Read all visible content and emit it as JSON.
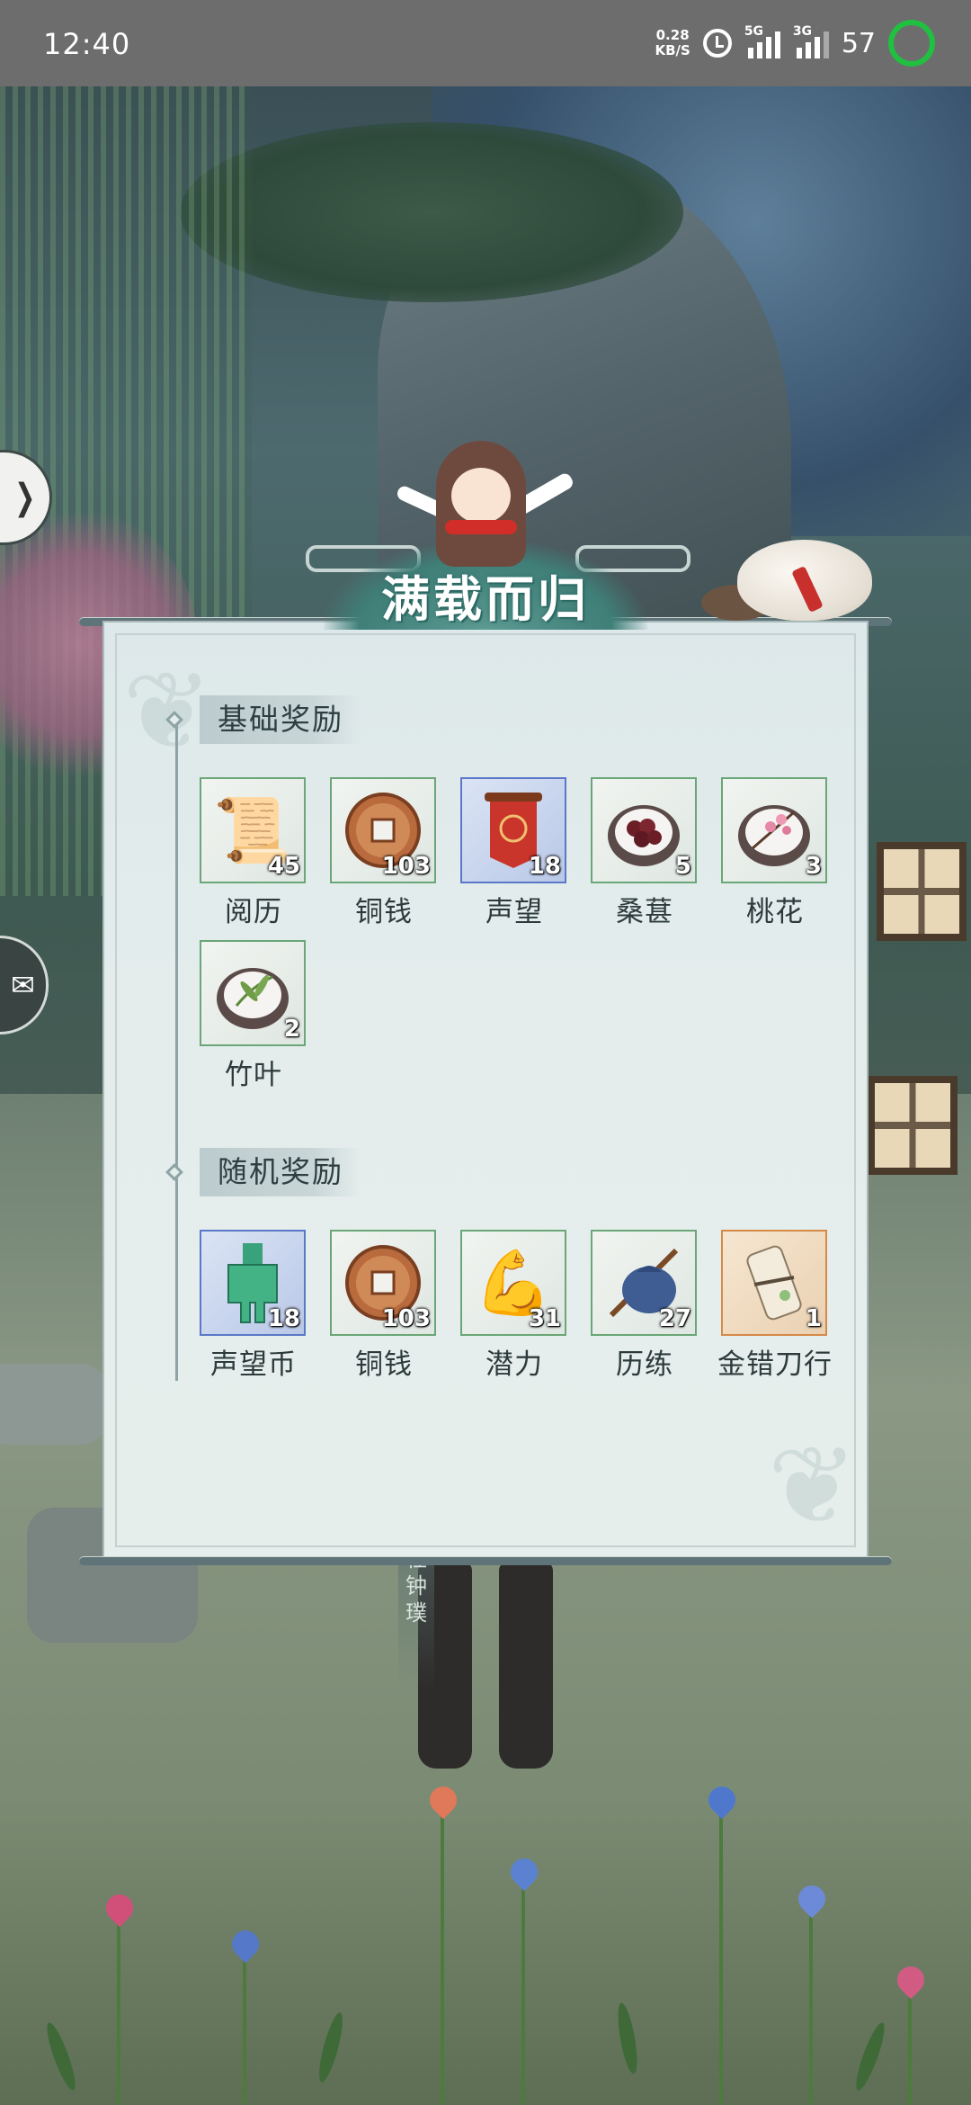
{
  "status_bar": {
    "time": "12:40",
    "net_speed_value": "0.28",
    "net_speed_unit": "KB/S",
    "sig1_type": "5G",
    "sig2_type": "3G",
    "battery": "57"
  },
  "scene": {
    "npc_name": "杜钟璞"
  },
  "panel": {
    "title": "满载而归",
    "sections": [
      {
        "title": "基础奖励",
        "items": [
          {
            "name": "阅历",
            "count": "45",
            "rarity": "green",
            "icon": "scroll-icon"
          },
          {
            "name": "铜钱",
            "count": "103",
            "rarity": "green",
            "icon": "copper-coin-icon"
          },
          {
            "name": "声望",
            "count": "18",
            "rarity": "blue",
            "icon": "red-banner-icon"
          },
          {
            "name": "桑葚",
            "count": "5",
            "rarity": "green",
            "icon": "mulberry-icon"
          },
          {
            "name": "桃花",
            "count": "3",
            "rarity": "green",
            "icon": "peach-blossom-icon"
          },
          {
            "name": "竹叶",
            "count": "2",
            "rarity": "green",
            "icon": "bamboo-leaf-icon"
          }
        ]
      },
      {
        "title": "随机奖励",
        "items": [
          {
            "name": "声望币",
            "count": "18",
            "rarity": "blue",
            "icon": "jade-token-icon"
          },
          {
            "name": "铜钱",
            "count": "103",
            "rarity": "green",
            "icon": "copper-coin-icon"
          },
          {
            "name": "潜力",
            "count": "31",
            "rarity": "green",
            "icon": "flexed-arm-icon"
          },
          {
            "name": "历练",
            "count": "27",
            "rarity": "green",
            "icon": "travel-bundle-icon"
          },
          {
            "name": "金错刀行",
            "count": "1",
            "rarity": "gold",
            "icon": "paper-scroll-icon"
          }
        ]
      }
    ]
  }
}
